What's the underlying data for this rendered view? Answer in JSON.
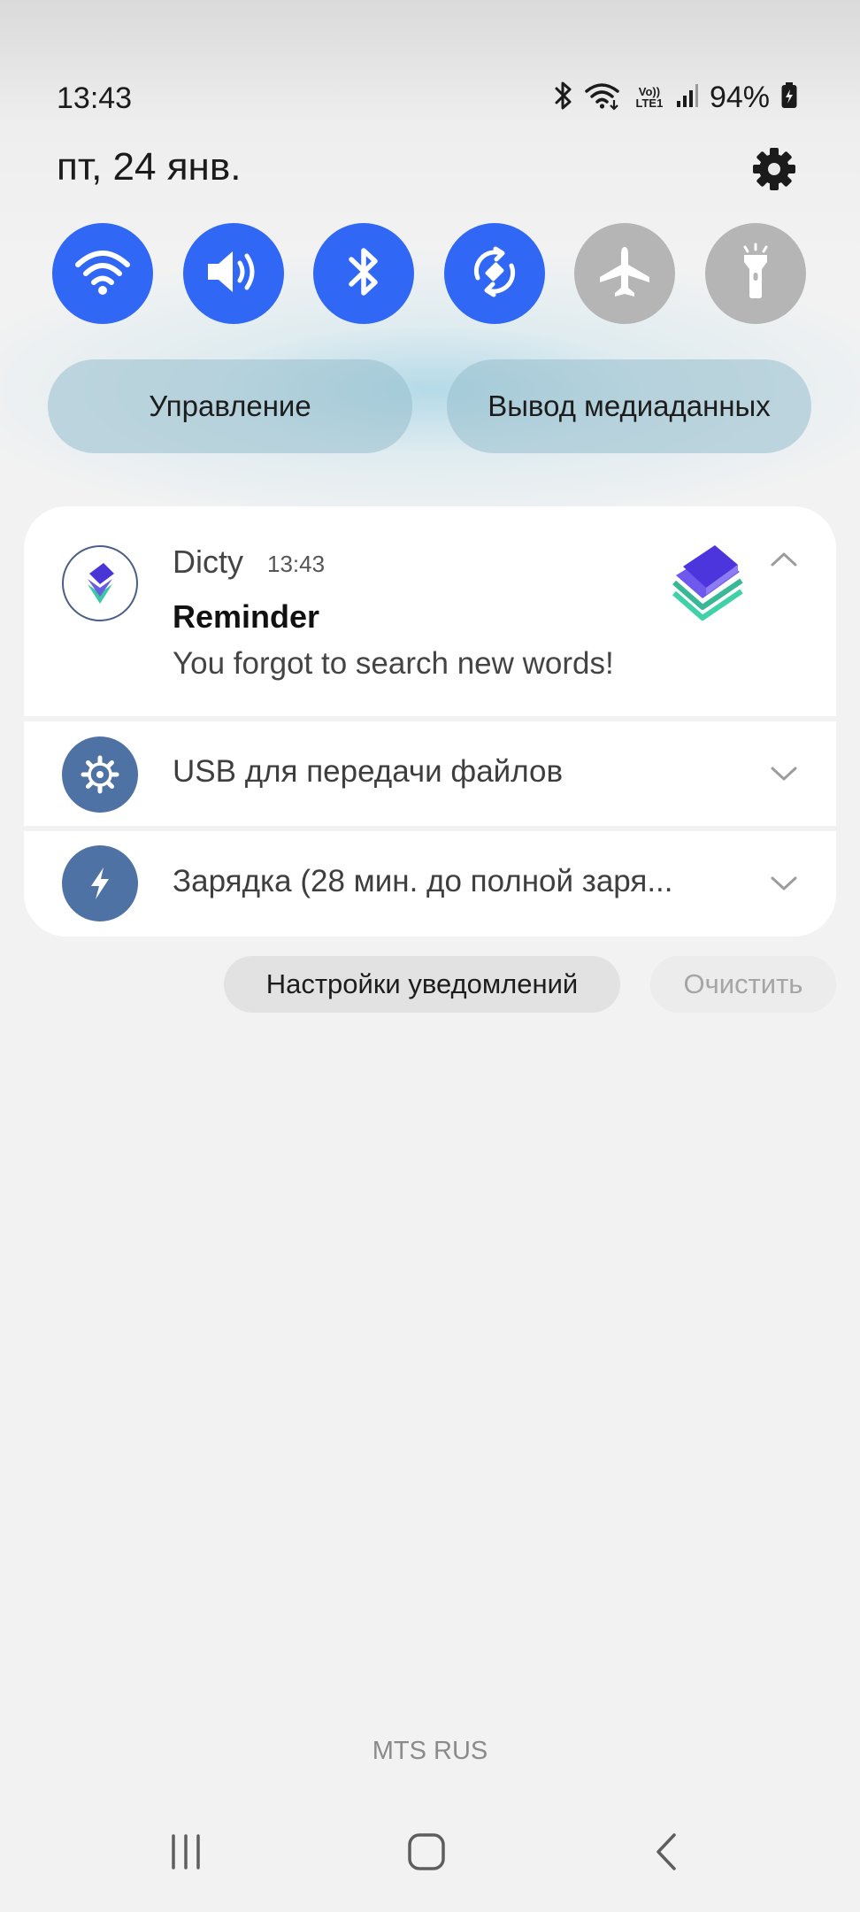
{
  "status_bar": {
    "time": "13:43",
    "volte_label": "Vo)) LTE1",
    "battery_percent": "94%",
    "icons": [
      "bluetooth-icon",
      "wifi-icon",
      "volte-icon",
      "signal-icon",
      "battery-icon"
    ]
  },
  "header": {
    "date": "пт, 24 янв."
  },
  "quick_toggles": [
    {
      "name": "wifi",
      "icon": "wifi-icon",
      "state": "on"
    },
    {
      "name": "sound",
      "icon": "volume-icon",
      "state": "on"
    },
    {
      "name": "bluetooth",
      "icon": "bluetooth-icon",
      "state": "on"
    },
    {
      "name": "auto-rotate",
      "icon": "rotate-icon",
      "state": "on"
    },
    {
      "name": "airplane-mode",
      "icon": "airplane-icon",
      "state": "off"
    },
    {
      "name": "flashlight",
      "icon": "flashlight-icon",
      "state": "off"
    }
  ],
  "pills": {
    "device_control": "Управление",
    "media_output": "Вывод медиаданных"
  },
  "notifications": {
    "dicty": {
      "app_name": "Dicty",
      "time": "13:43",
      "title": "Reminder",
      "body": "You forgot to search new words!"
    },
    "usb": {
      "text": "USB для передачи файлов"
    },
    "charging": {
      "text": "Зарядка (28 мин. до полной заря..."
    }
  },
  "actions": {
    "notification_settings": "Настройки уведомлений",
    "clear": "Очистить"
  },
  "carrier": "MTS RUS",
  "colors": {
    "toggle_on": "#3067f4",
    "toggle_off": "#b5b5b5",
    "system_icon_bg": "#4e72a4"
  }
}
